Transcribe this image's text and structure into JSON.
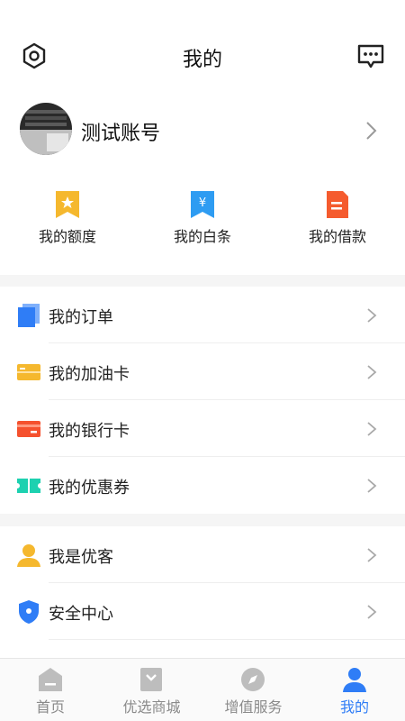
{
  "header": {
    "title": "我的",
    "settings_icon": "hexagon-settings-icon",
    "message_icon": "chat-bubble-icon"
  },
  "profile": {
    "name": "测试账号"
  },
  "quick_actions": [
    {
      "label": "我的额度",
      "icon": "star-ribbon-icon",
      "color": "#f5b82e"
    },
    {
      "label": "我的白条",
      "icon": "yen-ribbon-icon",
      "color": "#2e9cf2"
    },
    {
      "label": "我的借款",
      "icon": "document-icon",
      "color": "#f55b2e"
    }
  ],
  "menu_group_1": [
    {
      "label": "我的订单",
      "icon": "orders-icon",
      "color": "#2f7df6"
    },
    {
      "label": "我的加油卡",
      "icon": "fuel-card-icon",
      "color": "#f5b82e"
    },
    {
      "label": "我的银行卡",
      "icon": "bank-card-icon",
      "color": "#f5512e"
    },
    {
      "label": "我的优惠券",
      "icon": "coupon-icon",
      "color": "#1dd1b0"
    }
  ],
  "menu_group_2": [
    {
      "label": "我是优客",
      "icon": "user-icon",
      "color": "#f5b82e"
    },
    {
      "label": "安全中心",
      "icon": "shield-icon",
      "color": "#2f7df6"
    }
  ],
  "tabbar": [
    {
      "label": "首页",
      "icon": "home-icon",
      "active": false
    },
    {
      "label": "优选商城",
      "icon": "shop-icon",
      "active": false
    },
    {
      "label": "增值服务",
      "icon": "compass-icon",
      "active": false
    },
    {
      "label": "我的",
      "icon": "user-icon",
      "active": true
    }
  ],
  "colors": {
    "accent": "#2f7df6",
    "tab_inactive": "#8a8a8a"
  }
}
